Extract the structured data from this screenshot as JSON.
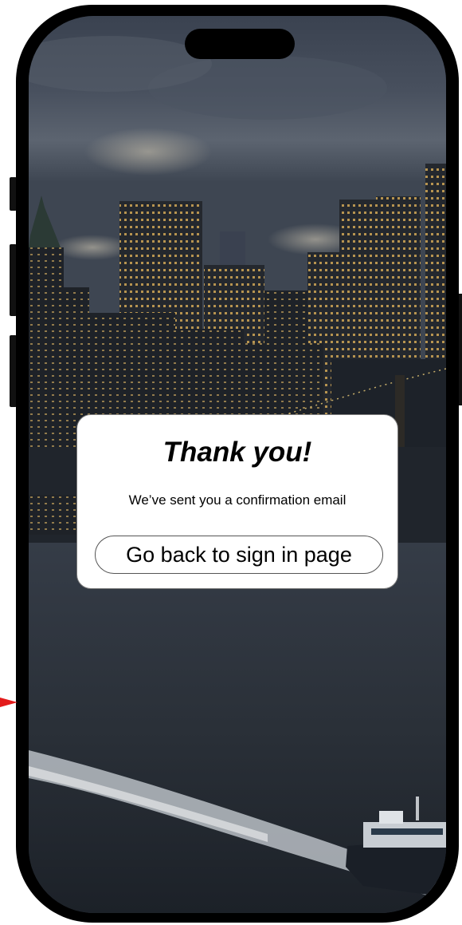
{
  "modal": {
    "title": "Thank you!",
    "message": "We’ve sent you a confirmation email",
    "back_button_label": "Go back to sign in page"
  },
  "colors": {
    "card_background": "#ffffff",
    "card_border": "#7a7a7a",
    "text": "#000000",
    "phone_frame": "#000000",
    "arrow": "#e31b1b"
  },
  "background_image": "night city skyline over river with boat",
  "icons": {
    "pointer": "red-arrow-icon"
  }
}
